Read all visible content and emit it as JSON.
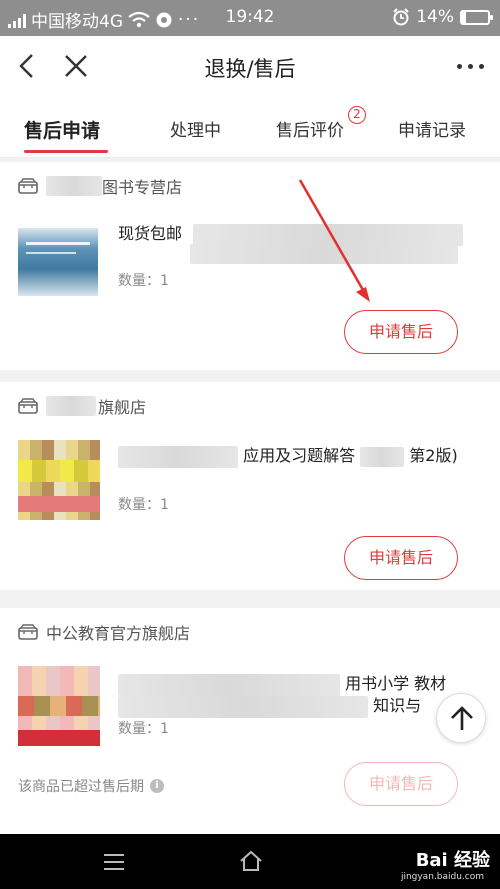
{
  "status_bar": {
    "carrier": "中国移动4G",
    "time": "19:42",
    "battery": "14%",
    "battery_level": 0.14
  },
  "nav": {
    "title": "退换/售后"
  },
  "tabs": [
    {
      "label": "售后申请"
    },
    {
      "label": "处理中"
    },
    {
      "label": "售后评价"
    },
    {
      "label": "申请记录"
    }
  ],
  "tab_badge": "2",
  "orders": [
    {
      "shop_name": "图书专营店",
      "product_name": "现货包邮",
      "quantity": "数量：1",
      "button": "申请售后"
    },
    {
      "shop_name": "旗舰店",
      "product_name": "应用及习题解答",
      "product_name_tail": "第2版)",
      "quantity": "数量：1",
      "button": "申请售后"
    },
    {
      "shop_name": "中公教育官方旗舰店",
      "product_name": "用书小学 教材",
      "product_name_line2": "知识与",
      "quantity": "数量：1",
      "button": "申请售后",
      "expired_note": "该商品已超过售后期"
    }
  ],
  "watermark": {
    "brand": "Bai 经验",
    "url": "jingyan.baidu.com"
  },
  "colors": {
    "accent": "#e4393c",
    "status_bar": "#8e8e8e"
  }
}
